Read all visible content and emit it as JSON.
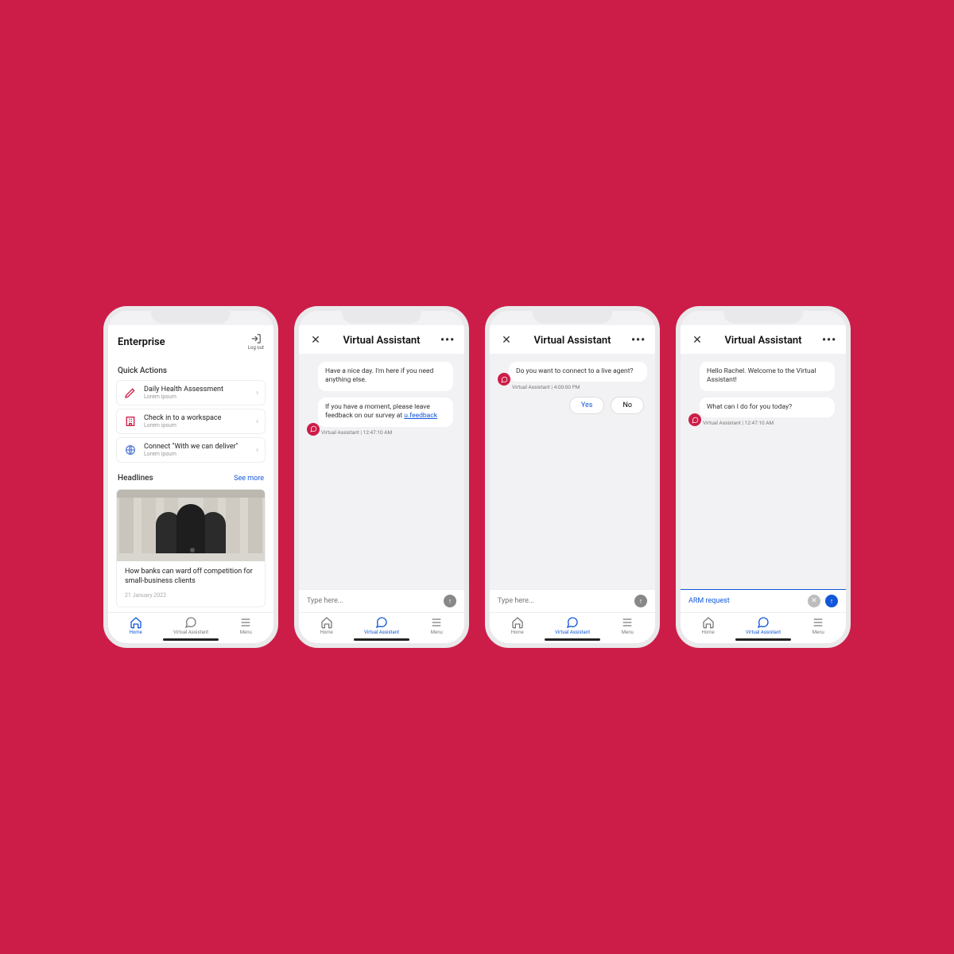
{
  "colors": {
    "accent": "#1257d9",
    "brand_red": "#cc1d48",
    "bg_gray": "#f2f2f4"
  },
  "tabs": {
    "home": "Home",
    "assistant": "Virtual Assistant",
    "menu": "Menu"
  },
  "phone1": {
    "title": "Enterprise",
    "logout_label": "Log out",
    "quick_actions_label": "Quick Actions",
    "qa": [
      {
        "title": "Daily Health Assessment",
        "sub": "Lorem ipsum",
        "icon": "pen"
      },
      {
        "title": "Check in to a workspace",
        "sub": "Lorem ipsum",
        "icon": "building"
      },
      {
        "title": "Connect \"With we can deliver\"",
        "sub": "Lorem ipsum",
        "icon": "globe"
      }
    ],
    "headlines_label": "Headlines",
    "see_more": "See more",
    "card": {
      "title": "How banks can ward off competition for small-business clients",
      "date": "21 January 2022"
    }
  },
  "phone2": {
    "title": "Virtual Assistant",
    "messages": [
      {
        "text": "Have a nice day. I'm here if you need anything else."
      },
      {
        "text": "If you have a moment, please leave feedback on our survey at ",
        "link_text": "u.feedback"
      }
    ],
    "meta": "Virtual Assistant | 12:47:10 AM",
    "input_placeholder": "Type here..."
  },
  "phone3": {
    "title": "Virtual Assistant",
    "message": "Do you want to connect to a live agent?",
    "meta": "Virtual Assistant | 4:00:00 PM",
    "yes": "Yes",
    "no": "No",
    "input_placeholder": "Type here..."
  },
  "phone4": {
    "title": "Virtual Assistant",
    "messages": [
      {
        "text": "Hello Rachel. Welcome to the Virtual Assistant!"
      },
      {
        "text": "What can I do for you today?"
      }
    ],
    "meta": "Virtual Assistant | 12:47:10 AM",
    "input_value": "ARM request"
  }
}
